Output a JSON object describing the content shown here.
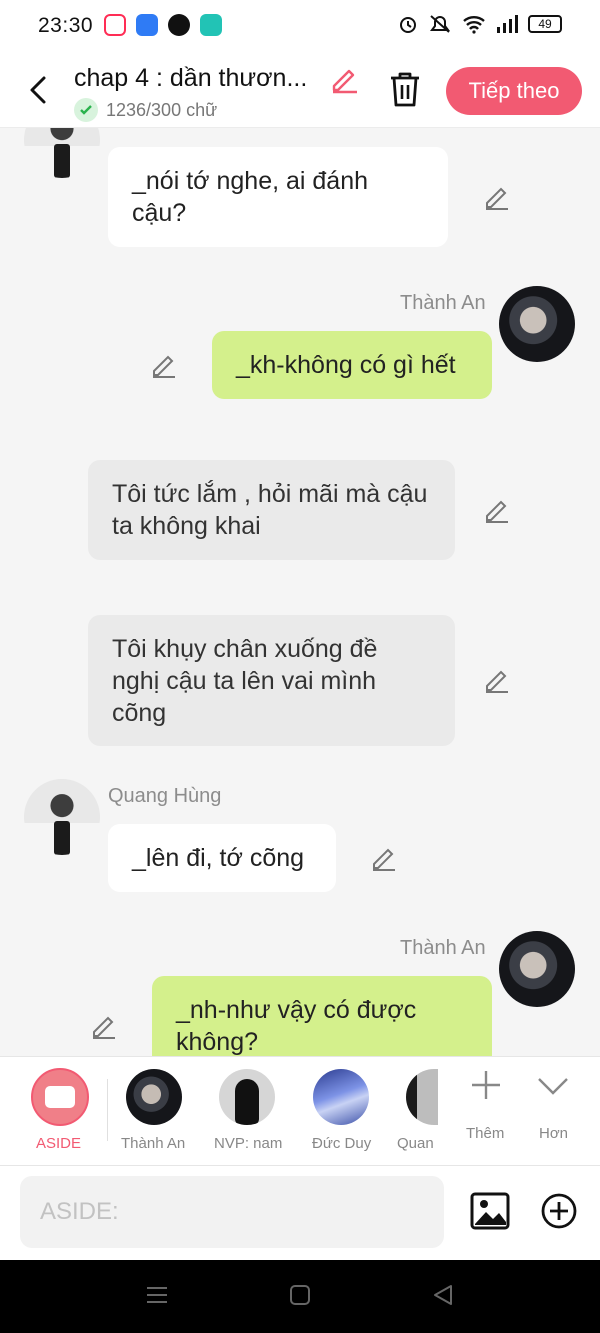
{
  "status_bar": {
    "time": "23:30",
    "battery": "49"
  },
  "header": {
    "title": "chap 4 : dần thươn...",
    "word_count": "1236/300 chữ",
    "next_button": "Tiếp theo"
  },
  "messages": [
    {
      "speaker": "",
      "text": "_nói tớ nghe, ai đánh cậu?",
      "style": "left"
    },
    {
      "speaker": "Thành An",
      "text": "_kh-không có gì hết",
      "style": "right"
    },
    {
      "speaker": "",
      "text": "Tôi tức lắm , hỏi mãi mà cậu ta không khai",
      "style": "aside"
    },
    {
      "speaker": "",
      "text": "Tôi khụy chân xuống đề nghị cậu ta lên vai mình cõng",
      "style": "aside"
    },
    {
      "speaker": "Quang Hùng",
      "text": "_lên đi, tớ cõng",
      "style": "left"
    },
    {
      "speaker": "Thành An",
      "text": "_nh-như vậy có được không?",
      "style": "right"
    }
  ],
  "character_bar": {
    "aside_label": "ASIDE",
    "characters": [
      {
        "name": "Thành An"
      },
      {
        "name": "NVP: nam"
      },
      {
        "name": "Đức Duy"
      },
      {
        "name": "Quan"
      }
    ],
    "add_label": "Thêm",
    "more_label": "Hơn"
  },
  "composer": {
    "placeholder": "ASIDE:"
  },
  "colors": {
    "accent": "#f25a72",
    "bubble_green": "#d4f08c",
    "bubble_gray": "#eaeaea"
  }
}
